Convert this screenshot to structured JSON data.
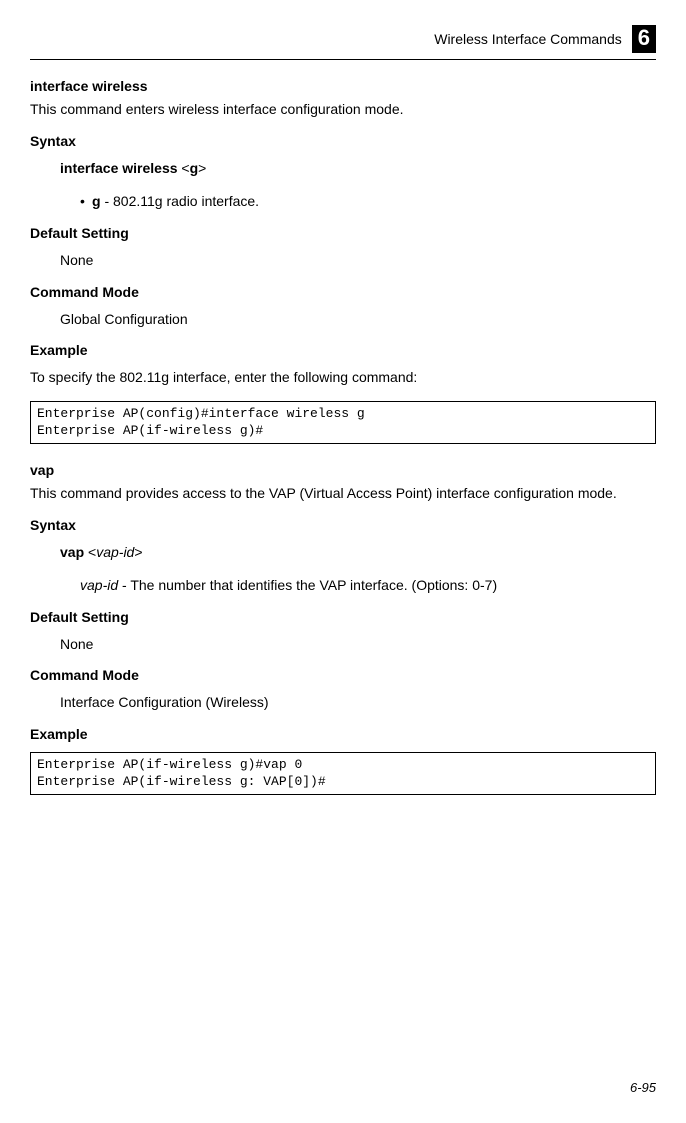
{
  "header": {
    "title": "Wireless Interface Commands",
    "chapter_num": "6"
  },
  "cmd1": {
    "title": "interface wireless",
    "desc": "This command enters wireless interface configuration mode.",
    "syntax_label": "Syntax",
    "syntax_bold": "interface wireless",
    "syntax_arg": " <",
    "syntax_arg_bold": "g",
    "syntax_arg_close": ">",
    "bullet_dot": "•",
    "param_bold": "g",
    "param_desc": " - 802.11g radio interface.",
    "default_label": "Default Setting",
    "default_val": "None",
    "mode_label": "Command Mode",
    "mode_val": "Global Configuration",
    "example_label": "Example",
    "example_desc": "To specify the 802.11g interface, enter the following command:",
    "code": "Enterprise AP(config)#interface wireless g\nEnterprise AP(if-wireless g)#"
  },
  "cmd2": {
    "title": "vap",
    "desc": "This command provides access to the VAP (Virtual Access Point) interface configuration mode.",
    "syntax_label": "Syntax",
    "syntax_bold": "vap",
    "syntax_arg": " <",
    "syntax_arg_italic": "vap-id",
    "syntax_arg_close": ">",
    "param_italic": "vap-id",
    "param_desc": " - The number that identifies the VAP interface. (Options: 0-7)",
    "default_label": "Default Setting",
    "default_val": "None",
    "mode_label": "Command Mode",
    "mode_val": "Interface Configuration (Wireless)",
    "example_label": "Example",
    "code": "Enterprise AP(if-wireless g)#vap 0\nEnterprise AP(if-wireless g: VAP[0])#"
  },
  "footer": {
    "page_num": "6-95"
  }
}
